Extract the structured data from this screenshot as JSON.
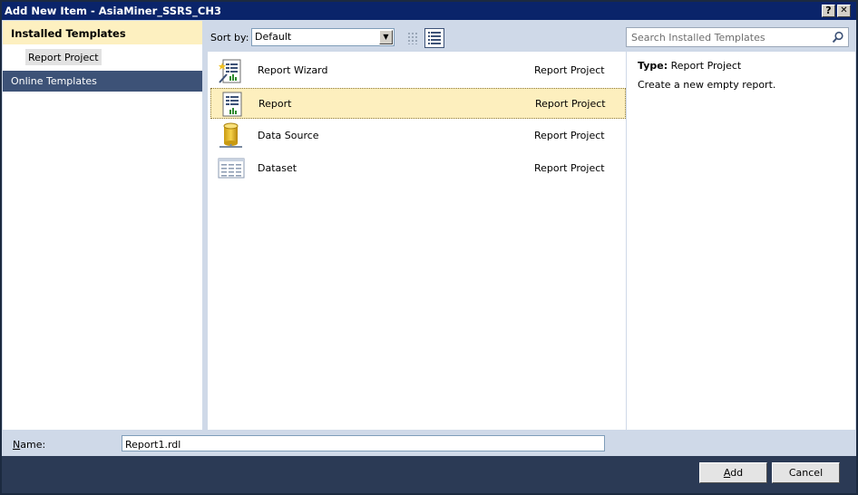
{
  "window": {
    "title": "Add New Item - AsiaMiner_SSRS_CH3",
    "help_label": "?",
    "close_label": "✕"
  },
  "left": {
    "installed_label": "Installed Templates",
    "sub_item_label": "Report Project",
    "online_label": "Online Templates"
  },
  "toolbar": {
    "sort_label": "Sort by:",
    "sort_value": "Default",
    "search_placeholder": "Search Installed Templates"
  },
  "items": [
    {
      "name": "Report Wizard",
      "category": "Report Project",
      "icon": "report-wizard-icon",
      "selected": false
    },
    {
      "name": "Report",
      "category": "Report Project",
      "icon": "report-icon",
      "selected": true
    },
    {
      "name": "Data Source",
      "category": "Report Project",
      "icon": "data-source-icon",
      "selected": false
    },
    {
      "name": "Dataset",
      "category": "Report Project",
      "icon": "dataset-icon",
      "selected": false
    }
  ],
  "details": {
    "type_label": "Type:",
    "type_value": "Report Project",
    "description": "Create a new empty report."
  },
  "name_field": {
    "label": "Name:",
    "value": "Report1.rdl"
  },
  "buttons": {
    "add_label": "Add",
    "cancel_label": "Cancel"
  },
  "colors": {
    "title_bg": "#0a246a",
    "header_highlight": "#fdf0c0",
    "selected_nav": "#3d5277",
    "selected_item": "#fdefbe",
    "footer_bg": "#2b3a55"
  }
}
